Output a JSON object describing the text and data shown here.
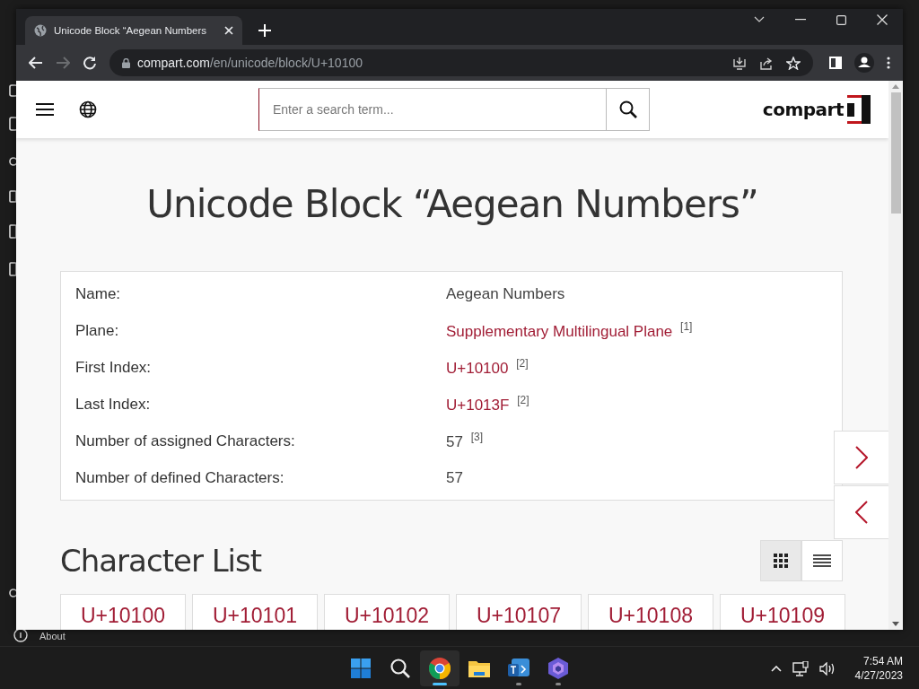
{
  "desktop": {
    "about": "About"
  },
  "browser": {
    "tab": {
      "title": "Unicode Block “Aegean Numbers"
    },
    "url": {
      "host": "compart.com",
      "path": "/en/unicode/block/U+10100"
    },
    "forward_disabled": true
  },
  "page": {
    "search": {
      "placeholder": "Enter a search term..."
    },
    "logo": "compart",
    "title": "Unicode Block “Aegean Numbers”",
    "properties": [
      {
        "label": "Name:",
        "value": "Aegean Numbers",
        "link": false
      },
      {
        "label": "Plane:",
        "value": "Supplementary Multilingual Plane",
        "link": true,
        "note": "[1]"
      },
      {
        "label": "First Index:",
        "value": "U+10100",
        "link": true,
        "note": "[2]"
      },
      {
        "label": "Last Index:",
        "value": "U+1013F",
        "link": true,
        "note": "[2]"
      },
      {
        "label": "Number of assigned Characters:",
        "value": "57",
        "link": false,
        "note": "[3]"
      },
      {
        "label": "Number of defined Characters:",
        "value": "57",
        "link": false
      }
    ],
    "character_list": {
      "heading": "Character List",
      "views": [
        {
          "kind": "grid",
          "selected": true
        },
        {
          "kind": "list",
          "selected": false
        }
      ],
      "characters": [
        "U+10100",
        "U+10101",
        "U+10102",
        "U+10107",
        "U+10108",
        "U+10109"
      ]
    }
  },
  "taskbar": {
    "apps": [
      {
        "kind": "start",
        "active": false,
        "open": false
      },
      {
        "kind": "search",
        "active": false,
        "open": false
      },
      {
        "kind": "chrome",
        "active": true,
        "open": true
      },
      {
        "kind": "files",
        "active": false,
        "open": false
      },
      {
        "kind": "teams",
        "active": false,
        "open": true
      },
      {
        "kind": "copilot",
        "active": false,
        "open": true
      }
    ],
    "time": "7:54 AM",
    "date": "4/27/2023"
  }
}
